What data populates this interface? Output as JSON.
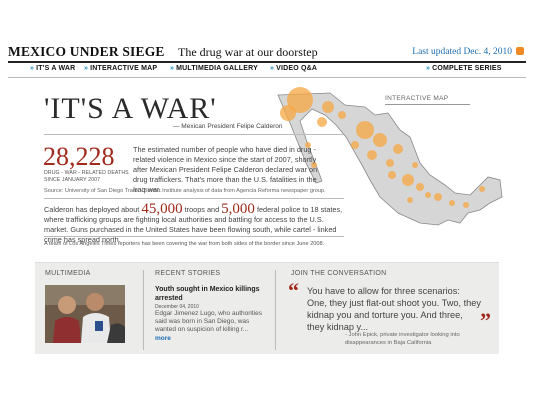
{
  "header": {
    "title": "MEXICO UNDER SIEGE",
    "subtitle": "The drug war at our doorstep",
    "updated": "Last updated Dec. 4, 2010",
    "rss_icon": "rss-icon"
  },
  "nav": {
    "items": [
      {
        "label": "IT'S A WAR"
      },
      {
        "label": "INTERACTIVE MAP"
      },
      {
        "label": "MULTIMEDIA GALLERY"
      },
      {
        "label": "VIDEO Q&A"
      },
      {
        "label": "COMPLETE SERIES"
      }
    ]
  },
  "hero": {
    "quote": "'IT'S A WAR'",
    "attribution": "— Mexican President Felipe Calderon",
    "deaths_number": "28,228",
    "deaths_label": "DRUG - WAR - RELATED DEATHS SINCE JANUARY 2007",
    "deaths_text": "The estimated number of people who have died in drug - related violence in Mexico since the start of 2007, shortly after Mexican President Felipe Calderon declared war on drug traffickers. That's more than the U.S. fatalities in the Iraq war.",
    "source": "Source: University of San Diego Trans - Border Institute analysis of data from Agencia Reforma newspaper group.",
    "troops_pre": "Calderon has deployed about",
    "troops_num": "45,000",
    "troops_mid": "troops and",
    "police_num": "5,000",
    "troops_post": "federal police to 18 states, where trafficking groups are fighting local authorities and battling for access to the U.S. market. Guns purchased in the United States have been flowing south, while cartel - linked crime has spread north.",
    "team_note": "A team of Los Angeles Times reporters has been covering the war from both sides of the border since June 2008."
  },
  "map": {
    "label": "INTERACTIVE MAP",
    "bubble_color": "#f5a742",
    "land_color": "#d6d6d6"
  },
  "panel": {
    "multimedia_head": "MULTIMEDIA",
    "recent_head": "RECENT STORIES",
    "story_title": "Youth sought in Mexico killings arrested",
    "story_date": "December 04, 2010",
    "story_body": "Edgar Jimenez Lugo, who authorities said was born in San Diego, was wanted on suspicion of killing r...",
    "story_more": "more",
    "conversation_head": "JOIN THE CONVERSATION",
    "quote_text": "You have to allow for three scenarios: One, they just flat-out shoot you. Two, they kidnap you and torture you. And three, they kidnap y...",
    "quote_attrib": "- John Epick, private investigator looking into disappearances in Baja California",
    "quote_open_mark": "“",
    "quote_close_mark": "”"
  },
  "colors": {
    "accent_red": "#a12a1d",
    "link_blue": "#1b6db3",
    "nav_chevron": "#1e8fbd"
  }
}
